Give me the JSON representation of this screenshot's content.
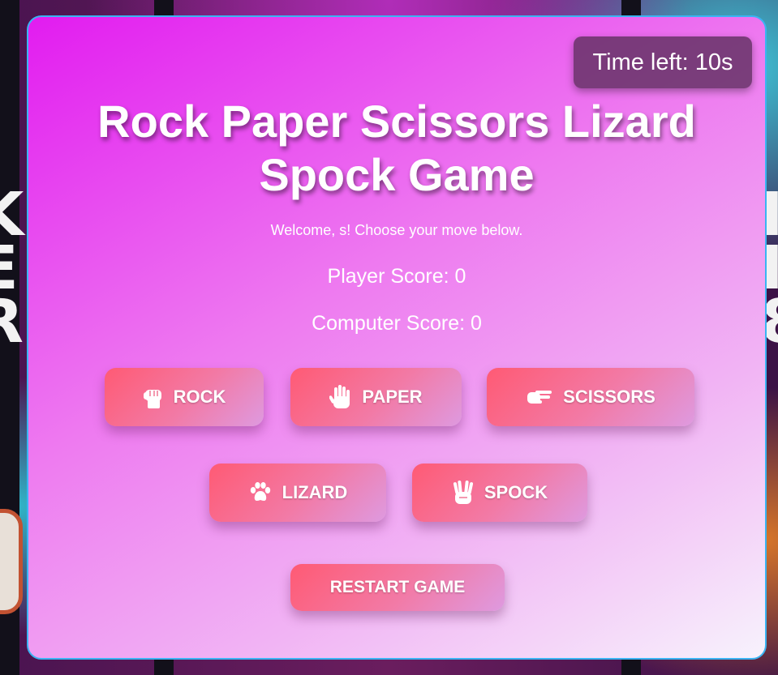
{
  "timer": {
    "text": "Time left: 10s"
  },
  "title": "Rock Paper Scissors Lizard Spock Game",
  "welcome": "Welcome, s! Choose your move below.",
  "scores": {
    "player": "Player Score: 0",
    "computer": "Computer Score: 0"
  },
  "choices": {
    "rock": {
      "label": "ROCK",
      "icon": "rock-hand-icon"
    },
    "paper": {
      "label": "PAPER",
      "icon": "paper-hand-icon"
    },
    "scissors": {
      "label": "SCISSORS",
      "icon": "scissors-hand-icon"
    },
    "lizard": {
      "label": "LIZARD",
      "icon": "paw-icon"
    },
    "spock": {
      "label": "SPOCK",
      "icon": "spock-hand-icon"
    }
  },
  "restart_label": "RESTART GAME",
  "colors": {
    "card_border": "#3ab4f2",
    "button_start": "#ff5a74",
    "button_end": "#de9ae0",
    "timer_bg": "#603060"
  }
}
